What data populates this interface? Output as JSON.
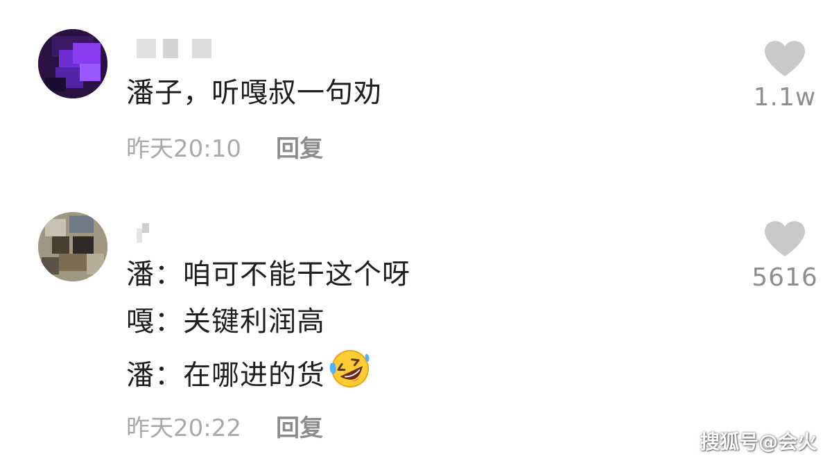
{
  "comments": [
    {
      "lines": [
        "潘子，听嘎叔一句劝"
      ],
      "time": "昨天20:10",
      "reply_label": "回复",
      "likes": "1.1w"
    },
    {
      "lines": [
        "潘：咱可不能干这个呀",
        "嘎：关键利润高",
        "潘：在哪进的货"
      ],
      "time": "昨天20:22",
      "reply_label": "回复",
      "likes": "5616"
    }
  ],
  "icons": {
    "like": "heart-icon",
    "emoji": "rolling-on-floor-laughing-emoji"
  },
  "colors": {
    "heart": "#c9c9c9",
    "meta_text": "#a9a9a9",
    "body_text": "#1e1e1e"
  },
  "watermark": "搜狐号@会火"
}
